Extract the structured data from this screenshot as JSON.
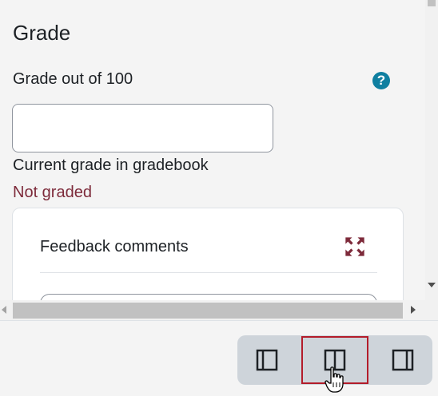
{
  "grade_section": {
    "title": "Grade",
    "grade_label": "Grade out of 100",
    "grade_value": "",
    "current_label": "Current grade in gradebook",
    "current_value": "Not graded"
  },
  "feedback": {
    "title": "Feedback comments",
    "expand_icon": "fullscreen-expand-icon"
  },
  "layout_buttons": [
    {
      "icon": "layout-left-panel-icon",
      "active": false
    },
    {
      "icon": "layout-split-panel-icon",
      "active": true
    },
    {
      "icon": "layout-right-panel-icon",
      "active": false
    }
  ],
  "colors": {
    "accent_red": "#7d2a3a",
    "help_blue": "#0f7fa0",
    "active_border": "#b31c2a"
  }
}
